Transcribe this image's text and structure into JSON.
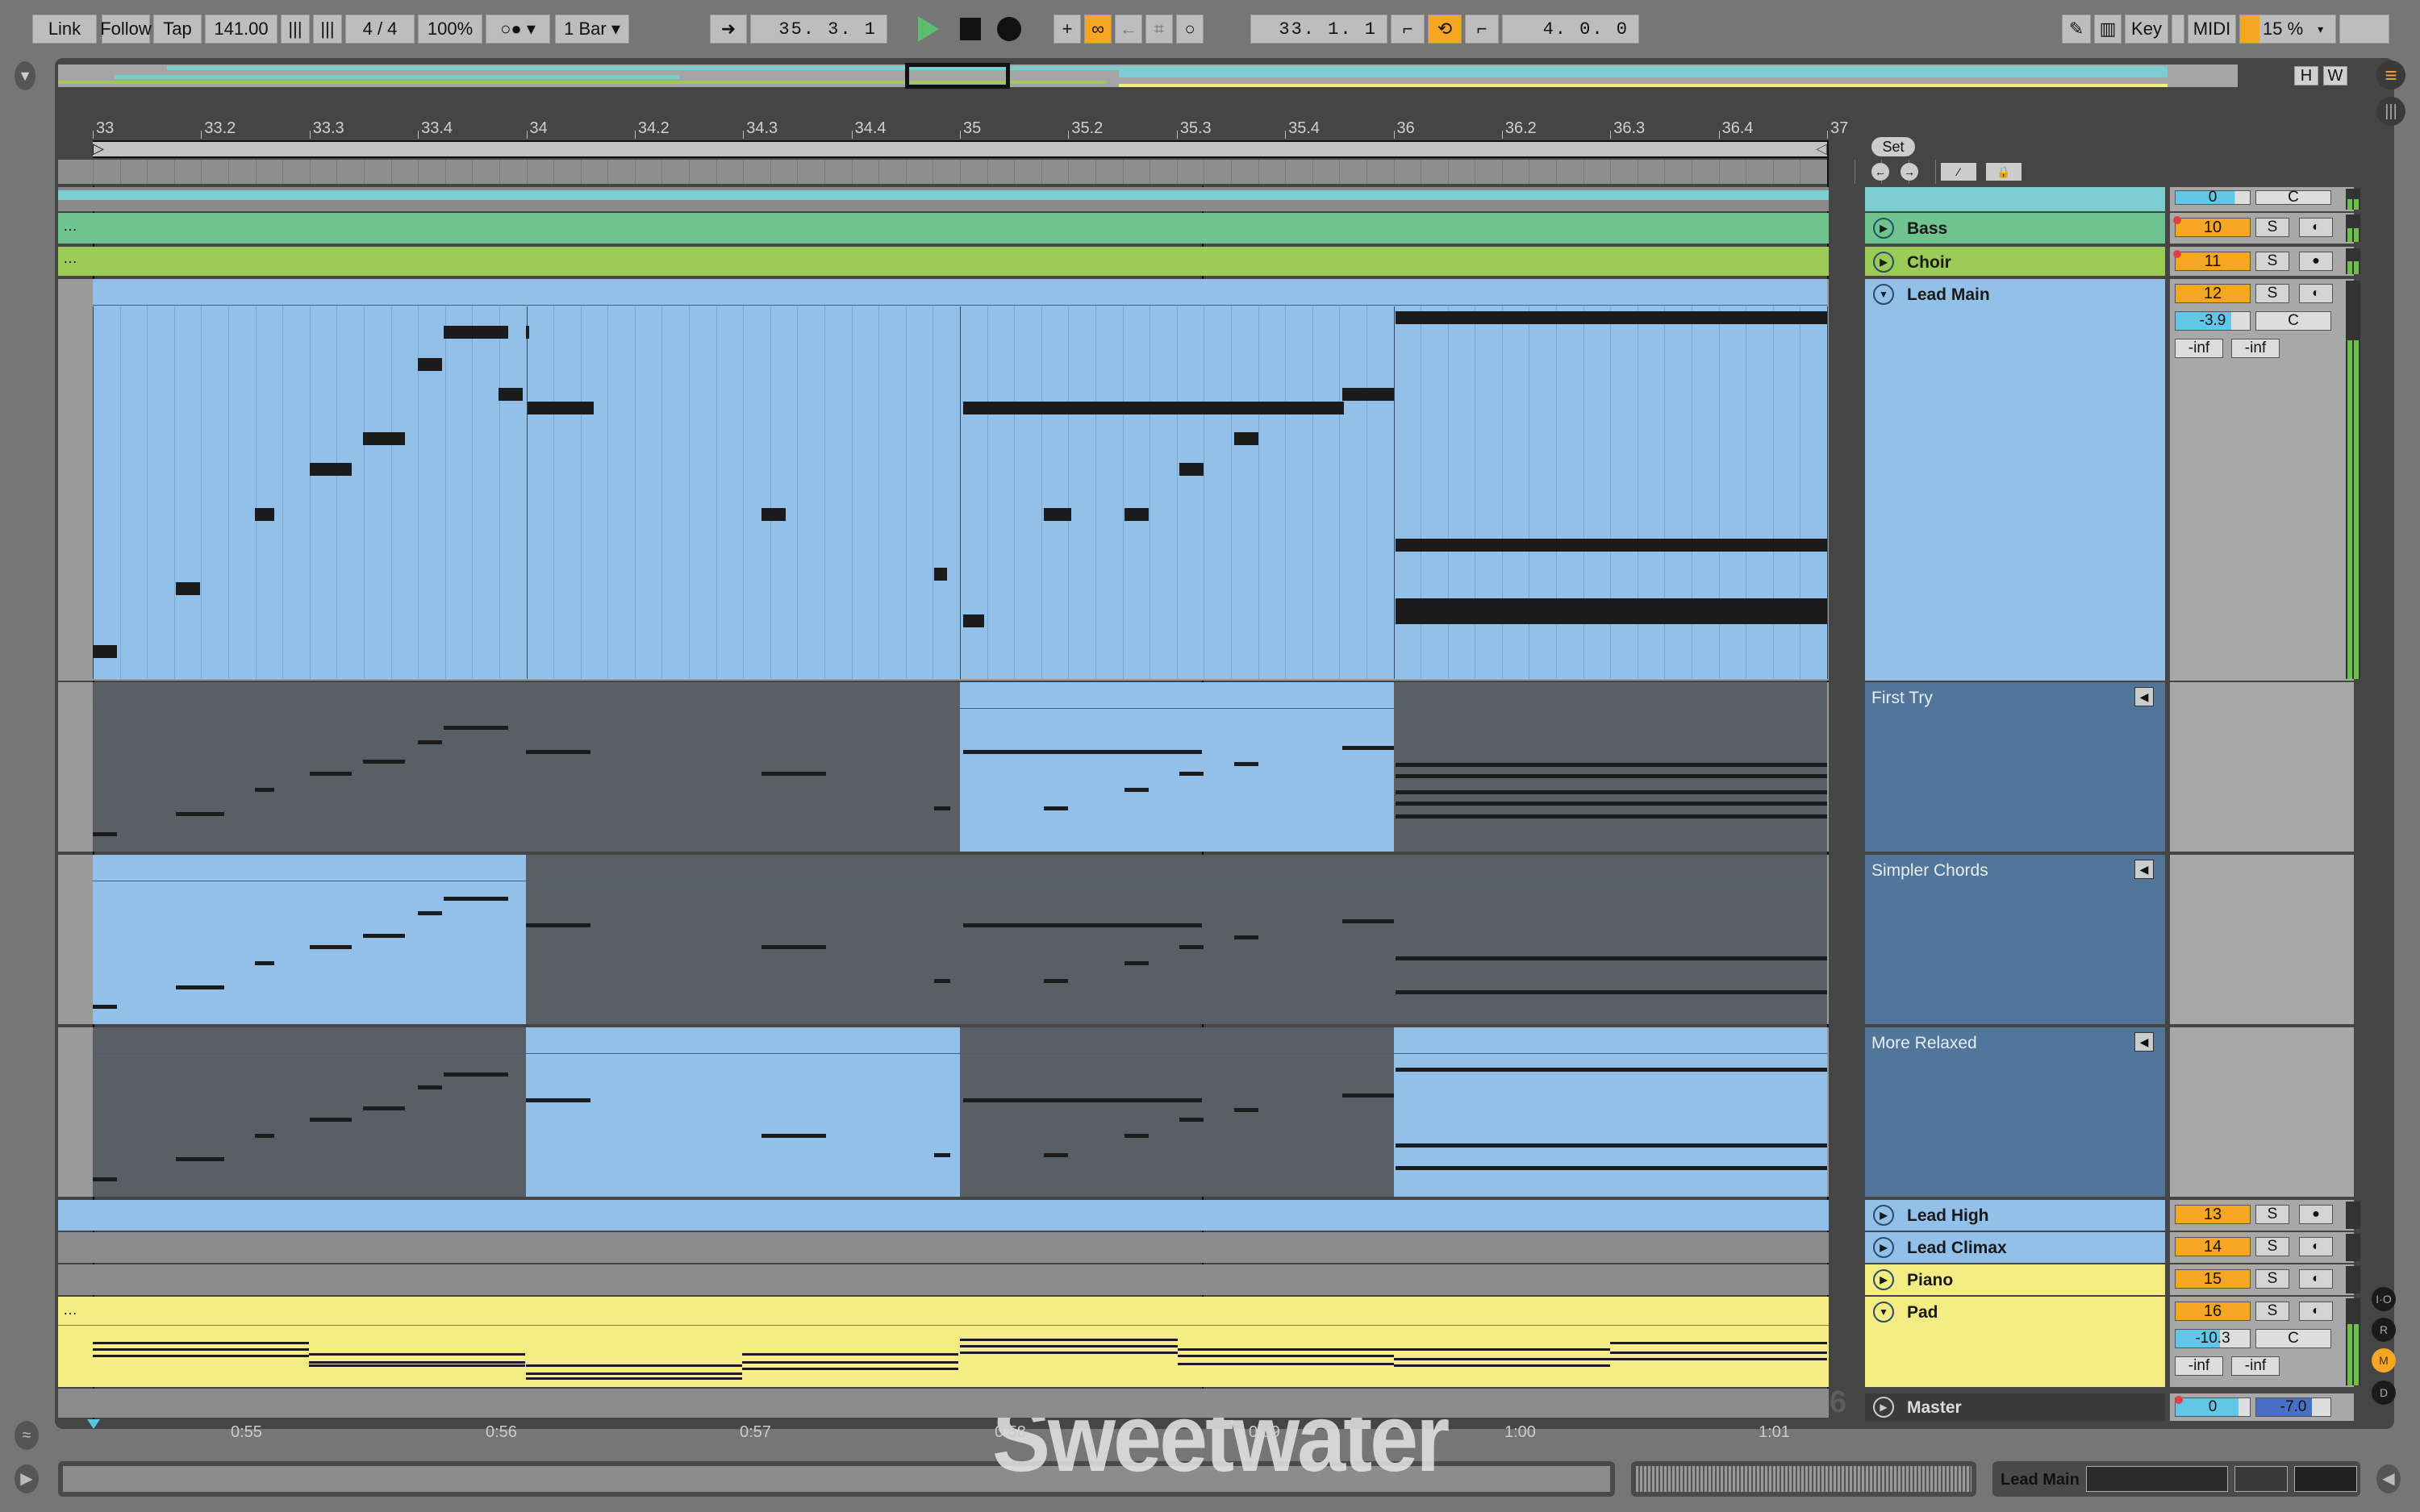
{
  "toolbar": {
    "link": "Link",
    "follow": "Follow",
    "tap": "Tap",
    "tempo": "141.00",
    "nudge_down_icon": "nudge-down-icon",
    "nudge_up_icon": "nudge-up-icon",
    "signature": "4 / 4",
    "groove": "100%",
    "metronome_icon": "metronome-icon",
    "quantize": "1 Bar",
    "follow_arrow_icon": "follow-arrow-icon",
    "position": "35.  3.  1",
    "loop_start": "33.  1.  1",
    "loop_length": "4.  0.  0",
    "key": "Key",
    "midi": "MIDI",
    "cpu": "15 %"
  },
  "overview": {
    "h": "H",
    "w": "W"
  },
  "ruler": {
    "labels": [
      "33",
      "33.2",
      "33.3",
      "33.4",
      "34",
      "34.2",
      "34.3",
      "34.4",
      "35",
      "35.2",
      "35.3",
      "35.4",
      "36",
      "36.2",
      "36.3",
      "36.4",
      "37"
    ]
  },
  "set_panel": {
    "set_label": "Set"
  },
  "tracks": [
    {
      "name": "",
      "number": "",
      "volume": "0",
      "pan": "C",
      "color": "#7ccdcf"
    },
    {
      "name": "Bass",
      "number": "10",
      "solo": "S",
      "color": "#6ec38f"
    },
    {
      "name": "Choir",
      "number": "11",
      "solo": "S",
      "color": "#9bcb56"
    },
    {
      "name": "Lead Main",
      "number": "12",
      "solo": "S",
      "volume": "-3.9",
      "pan": "C",
      "send_a": "-inf",
      "send_b": "-inf",
      "color": "#92c0e8"
    },
    {
      "name": "Lead High",
      "number": "13",
      "solo": "S",
      "color": "#92c0e8"
    },
    {
      "name": "Lead Climax",
      "number": "14",
      "solo": "S",
      "color": "#92c0e8"
    },
    {
      "name": "Piano",
      "number": "15",
      "solo": "S",
      "color": "#f5ec84"
    },
    {
      "name": "Pad",
      "number": "16",
      "solo": "S",
      "volume": "-10.3",
      "pan": "C",
      "send_a": "-inf",
      "send_b": "-inf",
      "color": "#f5ec84"
    }
  ],
  "takes": [
    {
      "name": "First Try"
    },
    {
      "name": "Simpler Chords"
    },
    {
      "name": "More Relaxed"
    }
  ],
  "master": {
    "name": "Master",
    "volume": "0",
    "pan": "-7.0"
  },
  "grid": {
    "fraction": "1/16"
  },
  "time_ruler": {
    "labels": [
      "0:55",
      "0:56",
      "0:57",
      "0:58",
      "0:59",
      "1:00",
      "1:01"
    ]
  },
  "right_panel": {
    "io": "I·O",
    "r": "R",
    "m": "M",
    "d": "D"
  },
  "status_bar": {
    "selected_track": "Lead Main"
  },
  "watermark": "Sweetwater",
  "colors": {
    "accent": "#f5a623",
    "play": "#5dbd6c",
    "lead": "#92c0e8",
    "take": "#52769a"
  }
}
